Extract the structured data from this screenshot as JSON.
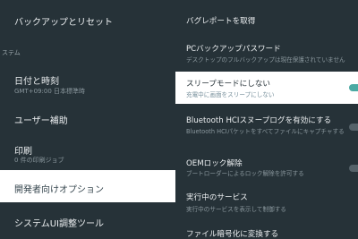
{
  "left_pane": {
    "items": [
      {
        "label": "バックアップとリセット"
      },
      {
        "section": "ステム"
      },
      {
        "label": "日付と時刻",
        "subtitle": "GMT+09:00 日本標準時"
      },
      {
        "label": "ユーザー補助"
      },
      {
        "label": "印刷",
        "subtitle": "0 件の印刷ジョブ"
      },
      {
        "label": "開発者向けオプション",
        "selected": true
      },
      {
        "label": "システムUI調整ツール"
      }
    ]
  },
  "right_pane": {
    "items": [
      {
        "label": "バグレポートを取得"
      },
      {
        "label": "PCバックアップパスワード",
        "subtitle": "デスクトップのフルバックアップは現在保護されていません"
      },
      {
        "label": "スリープモードにしない",
        "subtitle": "充電中に画面をスリープにしない",
        "highlighted": true,
        "toggle": "on"
      },
      {
        "label": "Bluetooth HCIスヌープログを有効にする",
        "subtitle": "Bluetooth HCIパケットをすべてファイルにキャプチャする",
        "toggle": "off"
      },
      {
        "label": "OEMロック解除",
        "subtitle": "ブートローダーによるロック解除を許可する",
        "toggle": "off"
      },
      {
        "label": "実行中のサービス",
        "subtitle": "実行中のサービスを表示して制御する"
      },
      {
        "label": "ファイル暗号化に変換する"
      }
    ]
  },
  "colors": {
    "background": "#263238",
    "selected_background": "#ffffff",
    "toggle_on": "#4ba9a3",
    "toggle_off": "#556269"
  }
}
